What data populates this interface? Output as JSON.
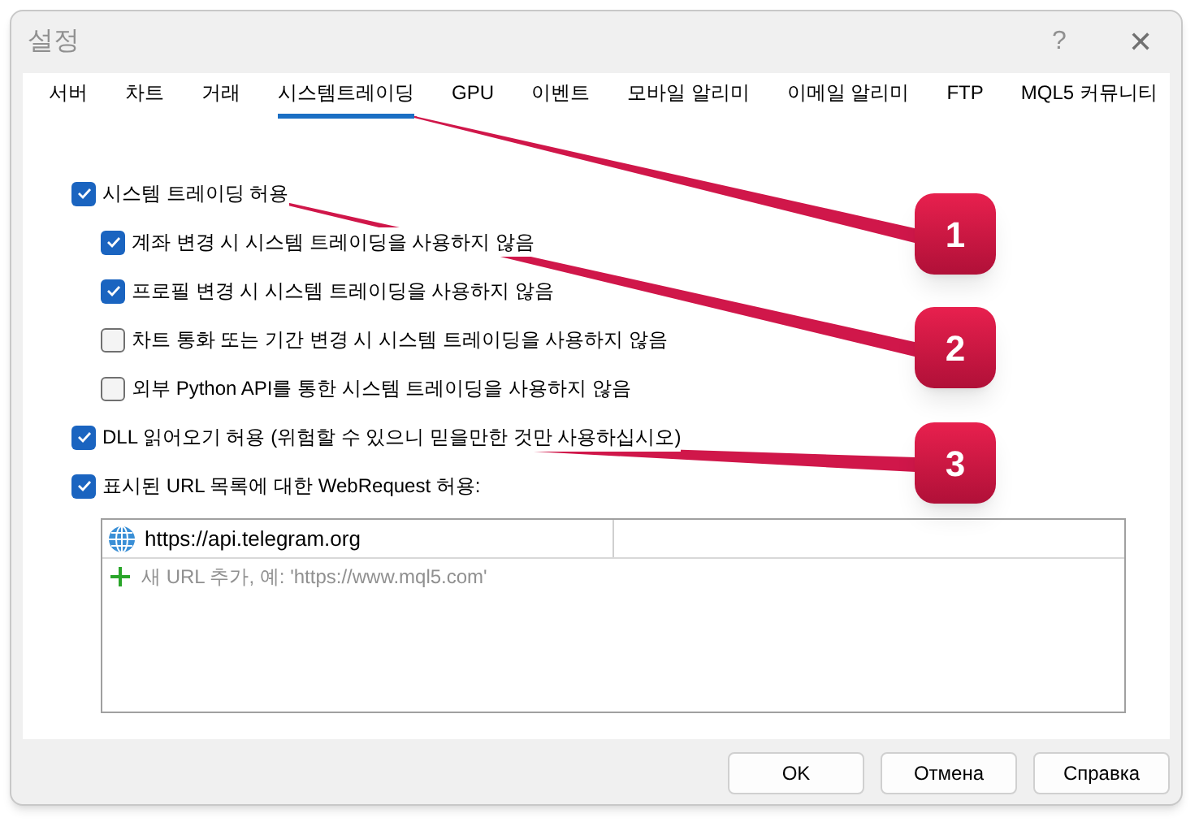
{
  "window": {
    "title": "설정",
    "help": "?",
    "close": "✕"
  },
  "tabs": [
    {
      "label": "서버",
      "selected": false
    },
    {
      "label": "차트",
      "selected": false
    },
    {
      "label": "거래",
      "selected": false
    },
    {
      "label": "시스템트레이딩",
      "selected": true
    },
    {
      "label": "GPU",
      "selected": false
    },
    {
      "label": "이벤트",
      "selected": false
    },
    {
      "label": "모바일 알리미",
      "selected": false
    },
    {
      "label": "이메일 알리미",
      "selected": false
    },
    {
      "label": "FTP",
      "selected": false
    },
    {
      "label": "MQL5 커뮤니티",
      "selected": false
    }
  ],
  "options": [
    {
      "label": "시스템 트레이딩 허용",
      "checked": true,
      "children": [
        {
          "label": "계좌 변경 시 시스템 트레이딩을 사용하지 않음",
          "checked": true
        },
        {
          "label": "프로필 변경 시 시스템 트레이딩을 사용하지 않음",
          "checked": true
        },
        {
          "label": "차트 통화 또는 기간 변경 시 시스템 트레이딩을 사용하지 않음",
          "checked": false
        },
        {
          "label": "외부 Python API를 통한 시스템 트레이딩을 사용하지 않음",
          "checked": false
        }
      ]
    },
    {
      "label": "DLL 읽어오기 허용 (위험할 수 있으니 믿을만한 것만 사용하십시오)",
      "checked": true
    },
    {
      "label": "표시된 URL 목록에 대한 WebRequest 허용:",
      "checked": true
    }
  ],
  "url_list": {
    "urls": [
      "https://api.telegram.org"
    ],
    "placeholder": "새 URL 추가, 예: 'https://www.mql5.com'"
  },
  "buttons": [
    "OK",
    "Отмена",
    "Справка"
  ],
  "callouts": [
    {
      "label": "1"
    },
    {
      "label": "2"
    },
    {
      "label": "3"
    }
  ]
}
